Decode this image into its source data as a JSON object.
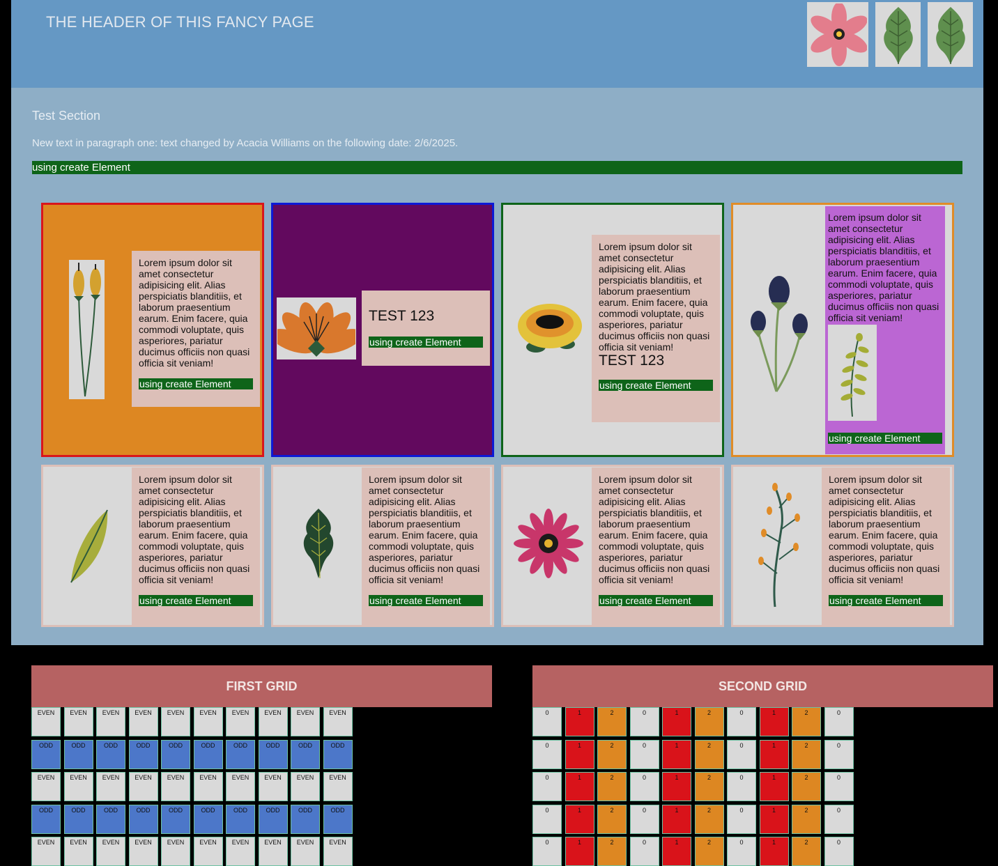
{
  "header": {
    "title": "THE HEADER OF THIS FANCY PAGE"
  },
  "section": {
    "title": "Test Section",
    "paragraph": "New text in paragraph one: text changed by Acacia Williams on the following date: 2/6/2025.",
    "bar_text": "using create Element"
  },
  "lorem": "Lorem ipsum dolor sit amet consectetur adipisicing elit. Alias perspiciatis blanditiis, et laborum praesentium earum. Enim facere, quia commodi voluptate, quis asperiores, pariatur ducimus officiis non quasi officia sit veniam!",
  "tag": "using create Element",
  "test_label": "TEST 123",
  "colors": {
    "header": "#6598c4",
    "section": "#8eaec6",
    "green": "#0e6419",
    "card1_bg": "#dd8722",
    "card1_border": "#d9161c",
    "card2_bg": "#62095e",
    "card2_border": "#0c1ad6",
    "card3_border": "#0e6419",
    "card4_border": "#e08c28",
    "card4_text": "#bb66d3",
    "grid_header": "#b66262",
    "odd": "#4c77c9",
    "red": "#d9131a",
    "orange": "#dd8722"
  },
  "grids": {
    "first": {
      "title": "FIRST GRID",
      "even_label": "EVEN",
      "odd_label": "ODD"
    },
    "second": {
      "title": "SECOND GRID",
      "values": [
        "0",
        "1",
        "2"
      ]
    }
  }
}
